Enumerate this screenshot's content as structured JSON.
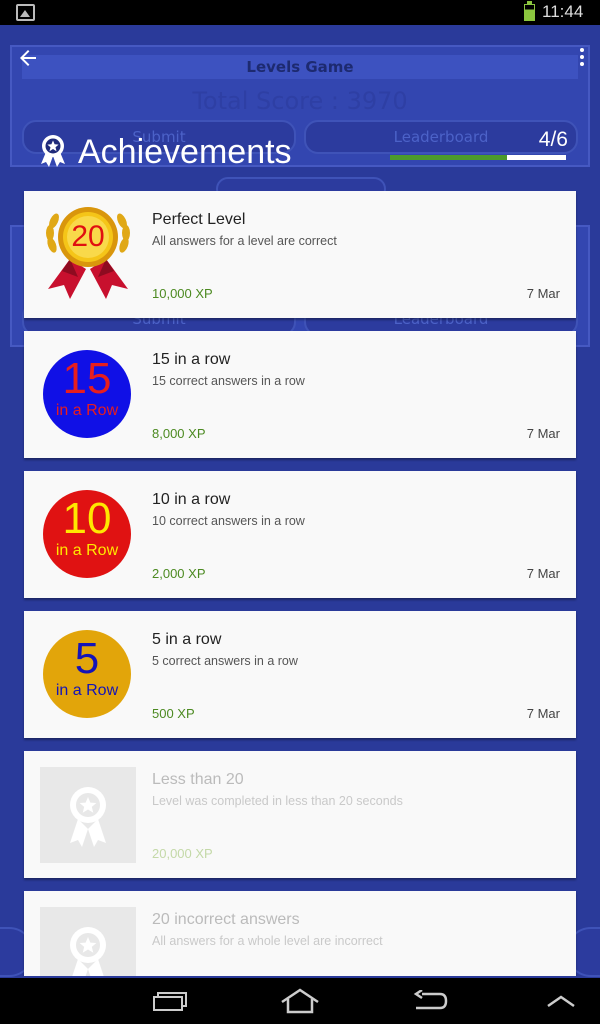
{
  "status_bar": {
    "time": "11:44"
  },
  "background_screen": {
    "title": "Levels Game",
    "score": "Total Score : 3970",
    "submit_label": "Submit",
    "leaderboard_label": "Leaderboard"
  },
  "header": {
    "title": "Achievements",
    "count": "4/6",
    "progress_fraction": 0.667
  },
  "achievements": [
    {
      "name": "Perfect Level",
      "description": "All answers for a level are correct",
      "xp": "10,000 XP",
      "date": "7 Mar",
      "badge_text": "20",
      "badge_type": "medal",
      "unlocked": true
    },
    {
      "name": "15 in a row",
      "description": "15 correct answers in a row",
      "xp": "8,000 XP",
      "date": "7 Mar",
      "badge_text": "15",
      "badge_sub": "in a Row",
      "badge_bg": "#1010e6",
      "badge_fg": "#e81e1e",
      "unlocked": true
    },
    {
      "name": "10 in a row",
      "description": "10 correct answers in a row",
      "xp": "2,000 XP",
      "date": "7 Mar",
      "badge_text": "10",
      "badge_sub": "in a Row",
      "badge_bg": "#e01212",
      "badge_fg": "#ffe800",
      "unlocked": true
    },
    {
      "name": "5 in a row",
      "description": "5 correct answers in a row",
      "xp": "500 XP",
      "date": "7 Mar",
      "badge_text": "5",
      "badge_sub": "in a Row",
      "badge_bg": "#e2a50a",
      "badge_fg": "#1414b8",
      "unlocked": true
    },
    {
      "name": "Less than 20",
      "description": "Level was completed in less than 20 seconds",
      "xp": "20,000 XP",
      "date": "",
      "unlocked": false
    },
    {
      "name": "20 incorrect answers",
      "description": "All answers for a whole level are incorrect",
      "xp": "",
      "date": "",
      "unlocked": false
    }
  ],
  "colors": {
    "background": "#1f2a7a",
    "xp_green": "#4c8a21",
    "progress_green": "#4c9a2a"
  },
  "icons": {
    "back": "back-arrow-icon",
    "menu": "overflow-menu-icon",
    "achievement": "award-ribbon-icon"
  }
}
